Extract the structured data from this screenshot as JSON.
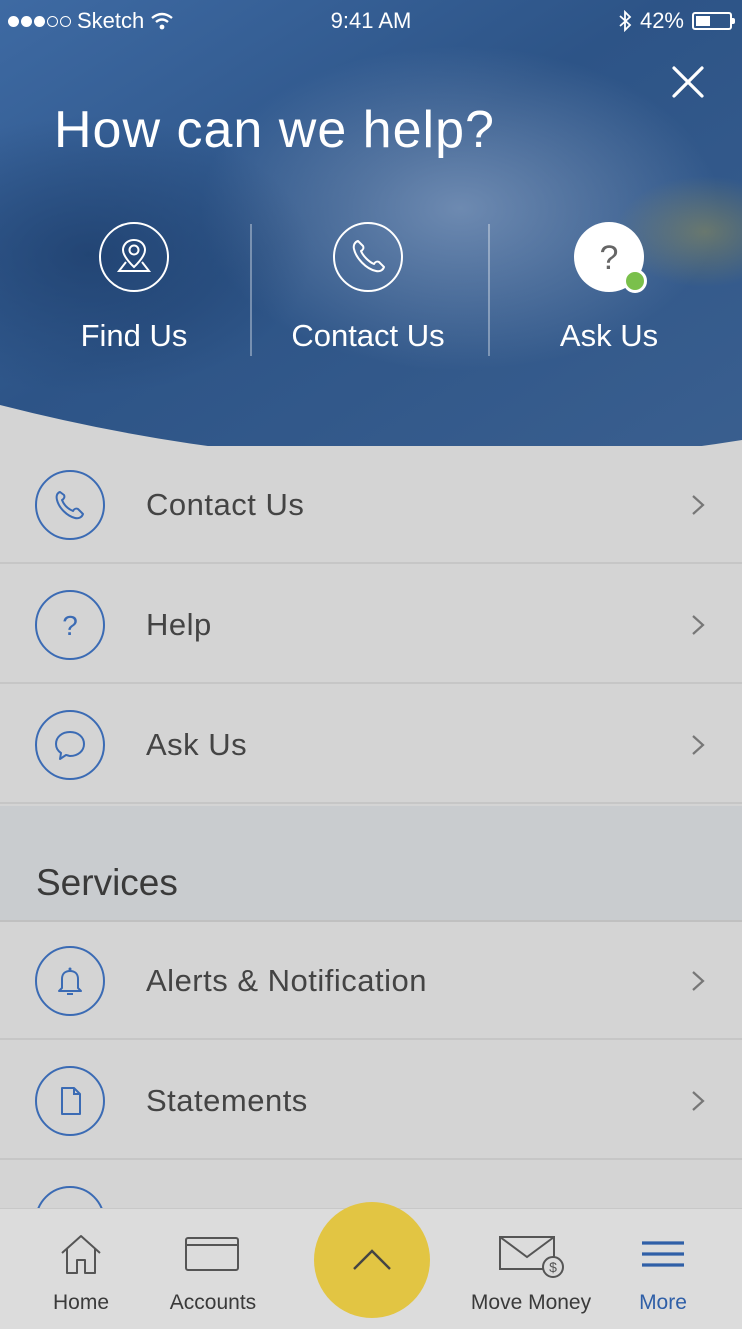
{
  "status_bar": {
    "carrier": "Sketch",
    "time": "9:41 AM",
    "battery": "42%"
  },
  "hero": {
    "title": "How can we help?",
    "quick_actions": [
      {
        "label": "Find Us",
        "icon": "location-pin-icon"
      },
      {
        "label": "Contact Us",
        "icon": "phone-icon"
      },
      {
        "label": "Ask Us",
        "icon": "help-chat-icon",
        "online": true
      }
    ]
  },
  "help_list": [
    {
      "label": "Contact Us",
      "icon": "phone-icon"
    },
    {
      "label": "Help",
      "icon": "question-icon"
    },
    {
      "label": "Ask Us",
      "icon": "chat-bubble-icon"
    }
  ],
  "services": {
    "title": "Services",
    "items": [
      {
        "label": "Alerts & Notification",
        "icon": "bell-icon"
      },
      {
        "label": "Statements",
        "icon": "document-icon"
      }
    ]
  },
  "tab_bar": {
    "tabs": [
      {
        "label": "Home",
        "icon": "home-icon"
      },
      {
        "label": "Accounts",
        "icon": "card-icon"
      },
      {
        "label": "Move Money",
        "icon": "envelope-money-icon"
      },
      {
        "label": "More",
        "icon": "menu-icon",
        "active": true
      }
    ],
    "fab_icon": "chevron-up-icon"
  },
  "colors": {
    "hero_blue": "#2f5b94",
    "accent_blue": "#3b6bb4",
    "online_green": "#7ac04b",
    "fab_yellow": "#e2c543"
  }
}
